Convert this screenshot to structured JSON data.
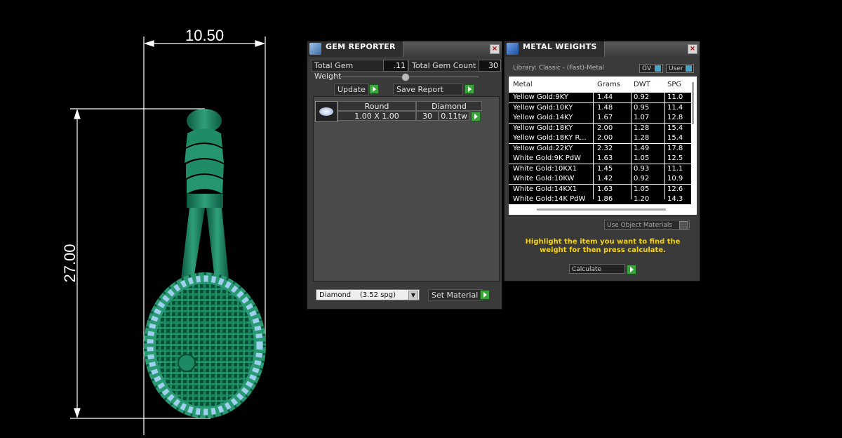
{
  "dimensions": {
    "width_label": "10.50",
    "height_label": "27.00"
  },
  "gem_reporter": {
    "title": "GEM REPORTER",
    "total_weight_label": "Total Gem Weight",
    "total_weight_value": ".11",
    "total_count_label": "Total Gem Count",
    "total_count_value": "30",
    "update_label": "Update",
    "save_report_label": "Save Report",
    "gem_row": {
      "shape_header": "Round",
      "type_header": "Diamond",
      "size": "1.00 X 1.00",
      "count": "30",
      "weight": "0.11tw"
    },
    "material_select": "Diamond    (3.52 spg)",
    "set_material_label": "Set Material"
  },
  "metal_weights": {
    "title": "METAL WEIGHTS",
    "library": "Library: Classic - (Fast)-Metal",
    "gv_label": "GV",
    "user_label": "User",
    "columns": [
      "Metal",
      "Grams",
      "DWT",
      "SPG"
    ],
    "rows": [
      [
        "Yellow Gold:9KY",
        "1.44",
        "0.92",
        "11.0"
      ],
      [
        "Yellow Gold:10KY",
        "1.48",
        "0.95",
        "11.4"
      ],
      [
        "Yellow Gold:14KY",
        "1.67",
        "1.07",
        "12.8"
      ],
      [
        "Yellow Gold:18KY",
        "2.00",
        "1.28",
        "15.4"
      ],
      [
        "Yellow Gold:18KY R...",
        "2.00",
        "1.28",
        "15.4"
      ],
      [
        "Yellow Gold:22KY",
        "2.32",
        "1.49",
        "17.8"
      ],
      [
        "White Gold:9K PdW",
        "1.63",
        "1.05",
        "12.5"
      ],
      [
        "White Gold:10KX1",
        "1.45",
        "0.93",
        "11.1"
      ],
      [
        "White Gold:10KW",
        "1.42",
        "0.92",
        "10.9"
      ],
      [
        "White Gold:14KX1",
        "1.63",
        "1.05",
        "12.6"
      ],
      [
        "White Gold:14K PdW",
        "1.86",
        "1.20",
        "14.3"
      ]
    ],
    "use_object_materials": "Use Object Materials",
    "note": "Highlight the item you want to find the weight for then press calculate.",
    "calculate_label": "Calculate"
  }
}
